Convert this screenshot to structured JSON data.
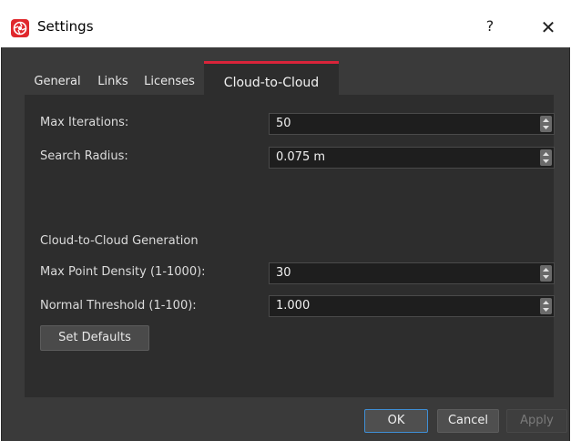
{
  "window": {
    "title": "Settings",
    "help_label": "?",
    "close_label": "✕",
    "icon": "app-logo-icon",
    "accent_color": "#d9243a"
  },
  "tabs": [
    {
      "label": "General",
      "active": false
    },
    {
      "label": "Links",
      "active": false
    },
    {
      "label": "Licenses",
      "active": false
    },
    {
      "label": "Cloud-to-Cloud",
      "active": true
    }
  ],
  "form": {
    "max_iterations": {
      "label": "Max Iterations:",
      "value": "50"
    },
    "search_radius": {
      "label": "Search Radius:",
      "value": "0.075 m"
    },
    "section_title": "Cloud-to-Cloud Generation",
    "max_point_density": {
      "label": "Max Point Density (1-1000):",
      "value": "30"
    },
    "normal_threshold": {
      "label": "Normal Threshold (1-100):",
      "value": "1.000"
    },
    "set_defaults_label": "Set Defaults"
  },
  "footer": {
    "ok_label": "OK",
    "cancel_label": "Cancel",
    "apply_label": "Apply",
    "apply_enabled": false
  }
}
